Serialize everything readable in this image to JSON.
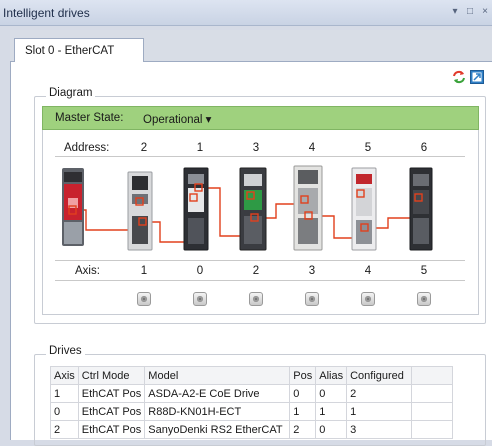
{
  "window": {
    "title": "Intelligent drives",
    "controls": {
      "dropdown": "▾",
      "restore": "□",
      "close": "×"
    }
  },
  "tabs": [
    {
      "label": "Slot 0 - EtherCAT"
    }
  ],
  "toolbar": {
    "icons": [
      "refresh-icon",
      "fit-view-icon"
    ]
  },
  "diagram": {
    "legend": "Diagram",
    "master_state_label": "Master State:",
    "master_state_value": "Operational ▾",
    "address_label": "Address:",
    "addresses": [
      "2",
      "1",
      "3",
      "4",
      "5",
      "6"
    ],
    "axis_label": "Axis:",
    "axes": [
      "1",
      "0",
      "2",
      "3",
      "4",
      "5"
    ],
    "colors": {
      "master_bar": "#9fd17e",
      "link": "#e2401d"
    }
  },
  "drives": {
    "legend": "Drives",
    "columns": [
      "Axis",
      "Ctrl Mode",
      "Model",
      "Pos",
      "Alias",
      "Configured",
      ""
    ],
    "rows": [
      [
        "1",
        "EthCAT Pos",
        "ASDA-A2-E CoE Drive",
        "0",
        "0",
        "2",
        ""
      ],
      [
        "0",
        "EthCAT Pos",
        "R88D-KN01H-ECT",
        "1",
        "1",
        "1",
        ""
      ],
      [
        "2",
        "EthCAT Pos",
        "SanyoDenki RS2 EtherCAT",
        "2",
        "0",
        "3",
        ""
      ]
    ]
  }
}
